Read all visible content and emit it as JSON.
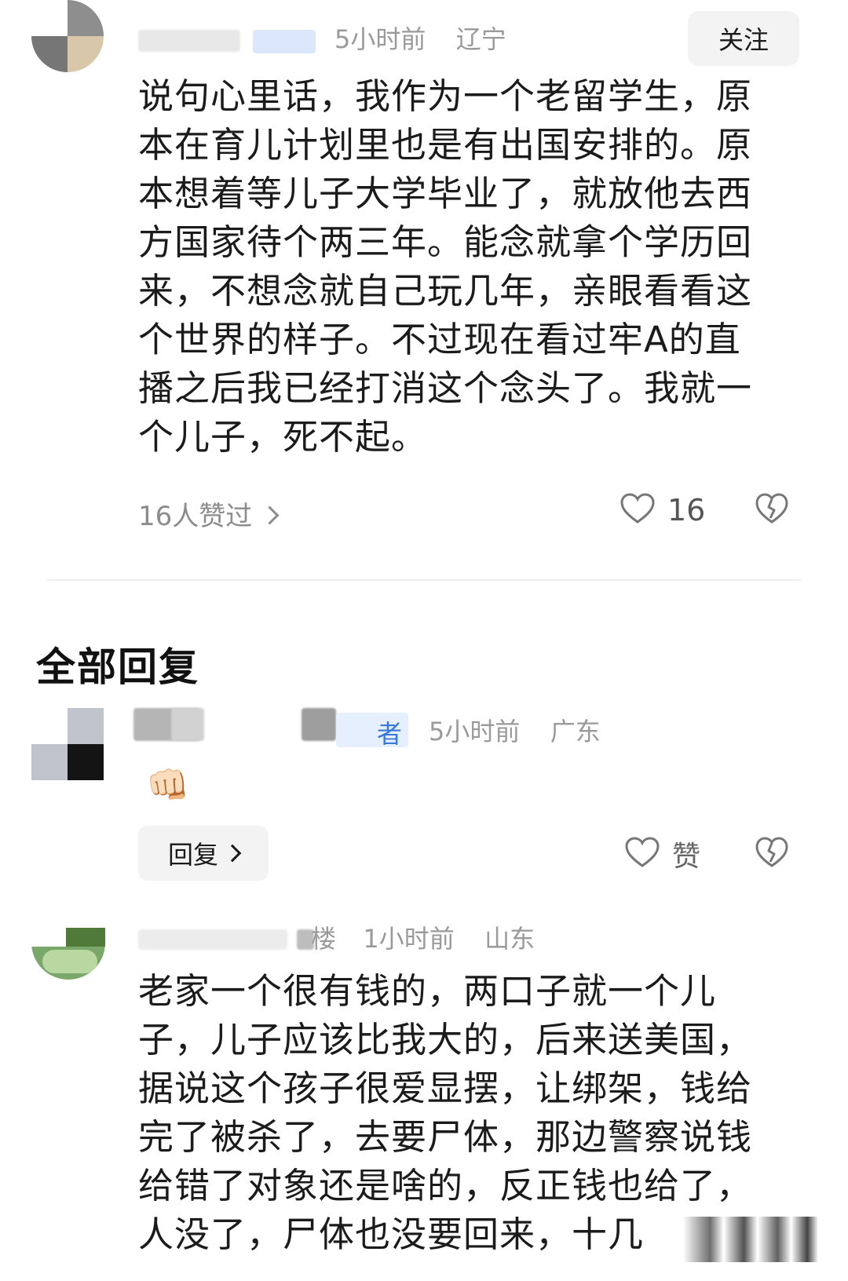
{
  "main_comment": {
    "time": "5小时前",
    "location": "辽宁",
    "follow_label": "关注",
    "text_lines": [
      "说句心里话，我作为一个老留学生，原",
      "本在育儿计划里也是有出国安排的。原",
      "本想着等儿子大学毕业了，就放他去西",
      "方国家待个两三年。能念就拿个学历回",
      "来，不想念就自己玩几年，亲眼看看这",
      "个世界的样子。不过现在看过牢A的直",
      "播之后我已经打消这个念头了。我就一",
      "个儿子，死不起。"
    ],
    "liked_by_label": "16人赞过",
    "like_count": "16"
  },
  "section_title": "全部回复",
  "reply_1": {
    "tag": "者",
    "time": "5小时前",
    "location": "广东",
    "emoji": "👊🏻",
    "reply_label": "回复",
    "like_label": "赞"
  },
  "reply_2": {
    "tag_fragment": "楼",
    "time": "1小时前",
    "location": "山东",
    "text_lines": [
      "老家一个很有钱的，两口子就一个儿",
      "子，儿子应该比我大的，后来送美国，",
      "据说这个孩子很爱显摆，让绑架，钱给",
      "完了被杀了，去要尸体，那边警察说钱",
      "给错了对象还是啥的，反正钱也给了，",
      "人没了，尸体也没要回来，十几"
    ]
  },
  "colors": {
    "meta_gray": "#9a9a9a",
    "text": "#1b1b1b",
    "button_bg": "#f3f3f3",
    "tag_blue": "#3a78d8"
  }
}
